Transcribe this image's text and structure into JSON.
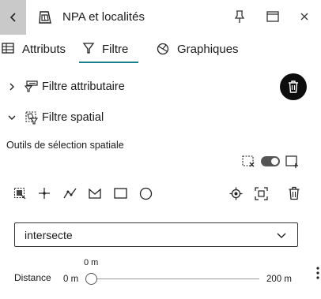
{
  "header": {
    "title": "NPA et localités",
    "icons": [
      "chevron-left-icon",
      "layer-icon",
      "pin-icon",
      "maximize-icon",
      "close-icon"
    ]
  },
  "tabs": [
    {
      "label": "Attributs",
      "icon": "table-icon",
      "active": false
    },
    {
      "label": "Filtre",
      "icon": "filter-icon",
      "active": true
    },
    {
      "label": "Graphiques",
      "icon": "chart-icon",
      "active": false
    }
  ],
  "sections": {
    "attribute_filter": {
      "label": "Filtre attributaire",
      "expanded": false
    },
    "spatial_filter": {
      "label": "Filtre spatial",
      "expanded": true
    }
  },
  "spatial_tools": {
    "heading": "Outils de sélection spatiale",
    "toggle_on": true,
    "tools": [
      "select-layer-icon",
      "point-icon",
      "polyline-icon",
      "freehand-polygon-icon",
      "rectangle-icon",
      "circle-icon",
      "locate-icon",
      "zoom-to-selection-icon",
      "delete-icon"
    ]
  },
  "relation": {
    "selected": "intersecte"
  },
  "distance": {
    "label": "Distance",
    "current": "0 m",
    "min": "0 m",
    "max": "200 m",
    "value_fraction": 0
  },
  "colors": {
    "accent": "#1a7f8c",
    "back_button_bg": "#c9c9c9",
    "trash_button_bg": "#0d0d0d"
  }
}
